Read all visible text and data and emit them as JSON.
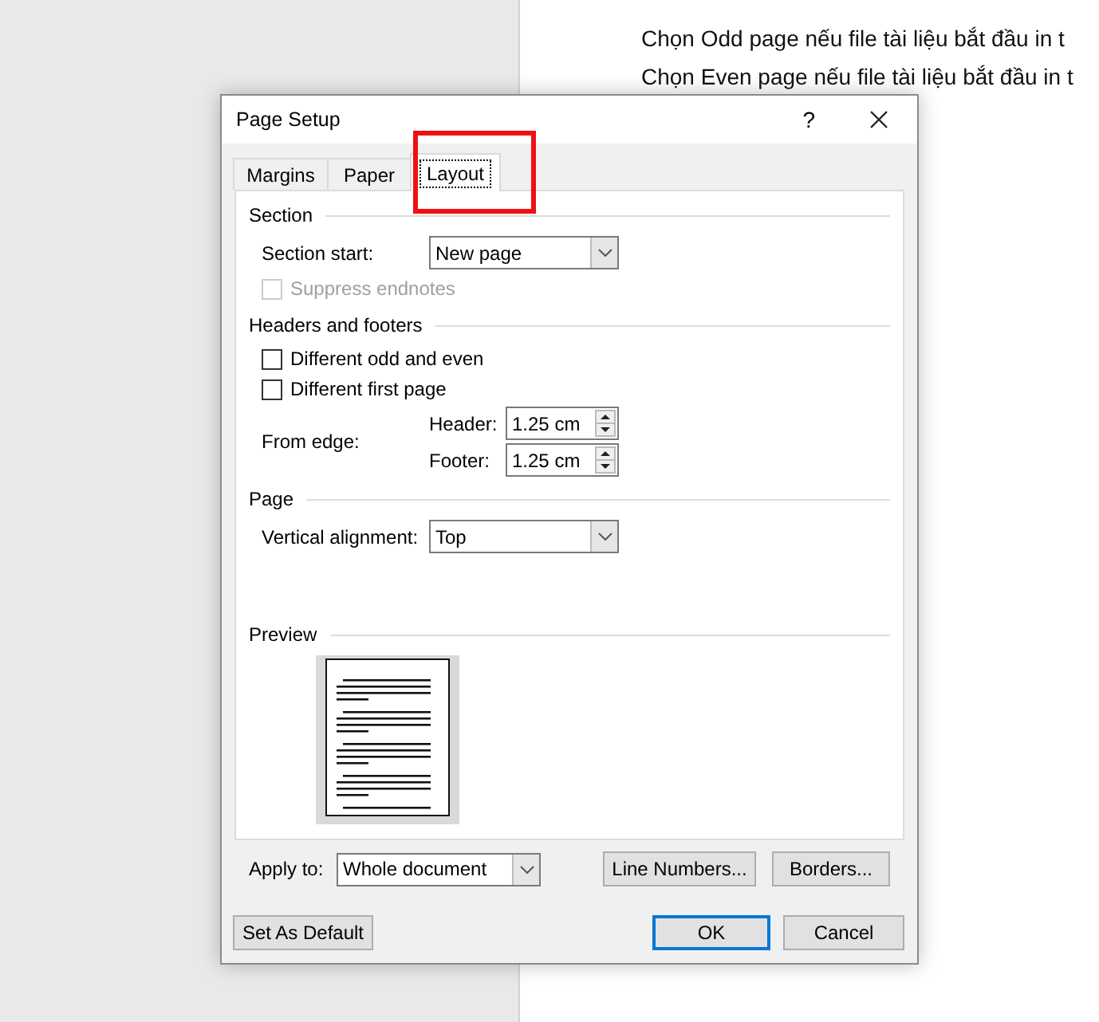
{
  "document": {
    "lines": [
      "Chọn Odd page nếu file tài liệu bắt đầu in t",
      "Chọn Even page nếu file tài liệu bắt đầu in t"
    ]
  },
  "dialog": {
    "title": "Page Setup",
    "help": "?",
    "tabs": [
      {
        "label": "Margins",
        "selected": false,
        "highlighted": false
      },
      {
        "label": "Paper",
        "selected": false,
        "highlighted": false
      },
      {
        "label": "Layout",
        "selected": true,
        "highlighted": true
      }
    ],
    "section": {
      "heading": "Section",
      "section_start": {
        "label": "Section start:",
        "value": "New page"
      },
      "suppress_endnotes": {
        "label": "Suppress endnotes",
        "checked": false,
        "disabled": true
      }
    },
    "headers_footers": {
      "heading": "Headers and footers",
      "checkboxes": [
        {
          "label": "Different odd and even",
          "checked": false,
          "disabled": false
        },
        {
          "label": "Different first page",
          "checked": false,
          "disabled": false
        }
      ],
      "from_edge": {
        "label": "From edge:",
        "fields": [
          {
            "label": "Header:",
            "value": "1.25 cm"
          },
          {
            "label": "Footer:",
            "value": "1.25 cm"
          }
        ]
      }
    },
    "page": {
      "heading": "Page",
      "vertical_alignment": {
        "label": "Vertical alignment:",
        "value": "Top"
      }
    },
    "preview": {
      "heading": "Preview"
    },
    "apply_to": {
      "label": "Apply to:",
      "value": "Whole document"
    },
    "panel_buttons": [
      "Line Numbers...",
      "Borders..."
    ],
    "footer_buttons": [
      {
        "label": "Set As Default",
        "default": false
      },
      {
        "label": "OK",
        "default": true
      },
      {
        "label": "Cancel",
        "default": false
      }
    ]
  }
}
